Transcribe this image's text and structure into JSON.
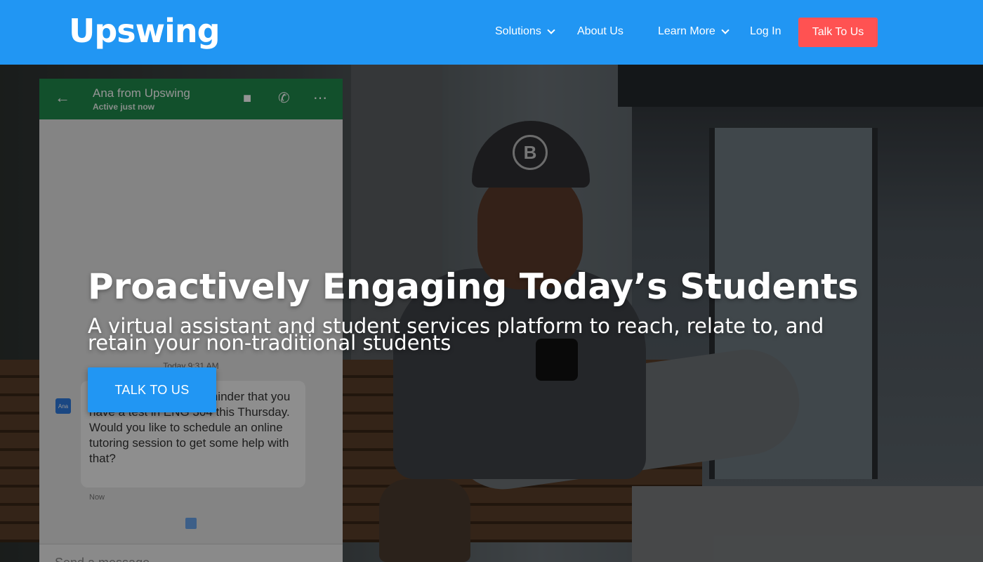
{
  "brand": {
    "logo_text": "Upswing",
    "primary_color": "#2196f3",
    "cta_color": "#ff5252"
  },
  "nav": {
    "solutions": "Solutions",
    "about": "About Us",
    "learn_more": "Learn More",
    "login": "Log In",
    "cta": "Talk To Us"
  },
  "hero": {
    "title": "Proactively Engaging Today’s Students",
    "subtitle": "A virtual assistant and student services platform to reach, relate to, and retain your non-traditional students",
    "cta": "TALK TO US"
  },
  "mockup": {
    "contact_name": "Ana from Upswing",
    "contact_status": "Active just now",
    "timestamp": "Today 9:31 AM",
    "avatar_label": "Ana",
    "message": "Hi Ana! Just a quick reminder that you have a test in ENG 304 this Thursday. Would you like to schedule an online tutoring session to get some help with that?",
    "message_time": "Now",
    "input_placeholder": "Send a message"
  },
  "background": {
    "cap_letter": "B"
  }
}
